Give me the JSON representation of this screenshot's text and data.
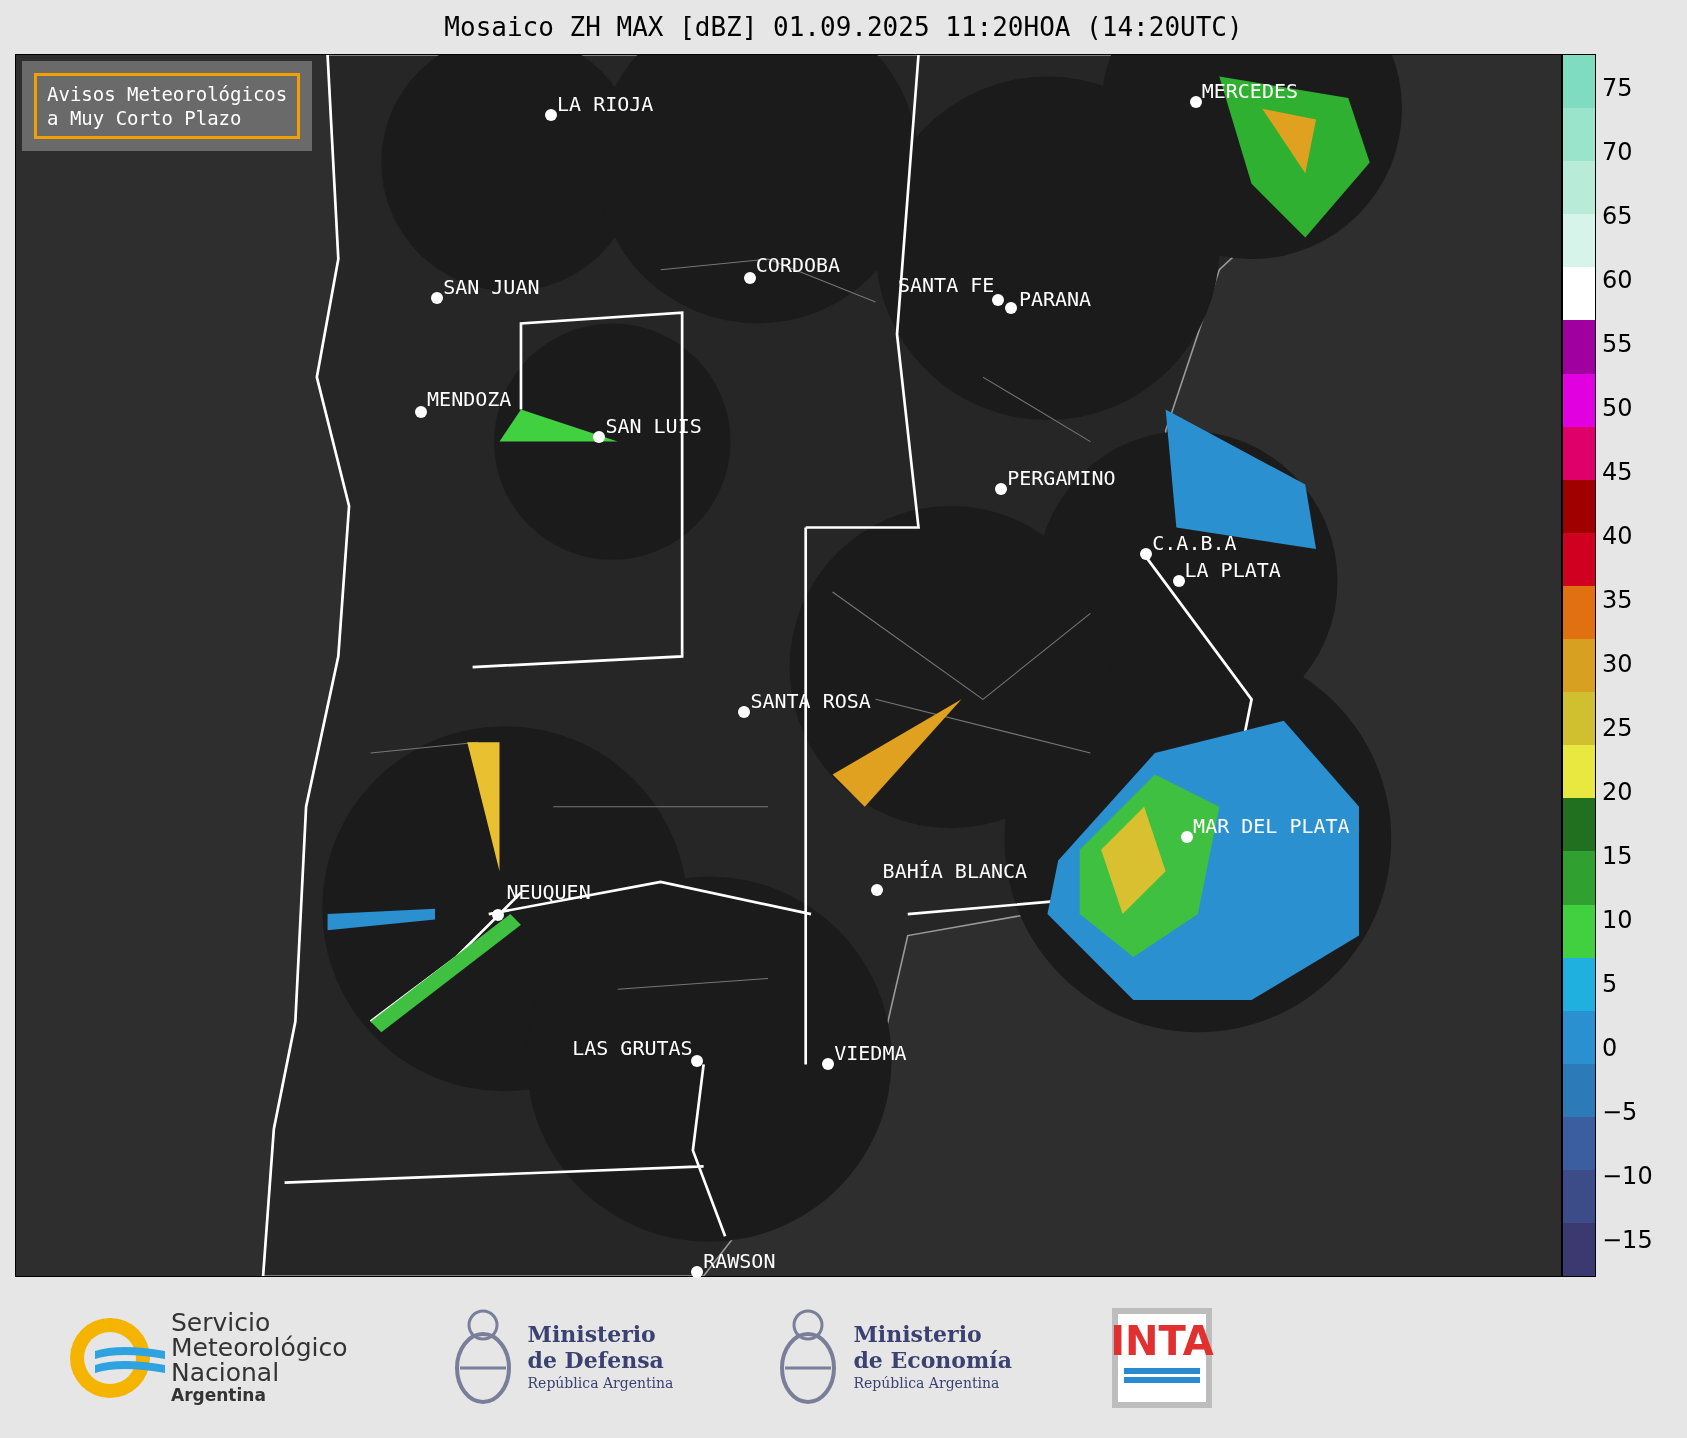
{
  "title": "Mosaico ZH MAX [dBZ] 01.09.2025 11:20HOA (14:20UTC)",
  "notice": {
    "lines": [
      "Avisos Meteorológicos",
      "a Muy Corto Plazo"
    ]
  },
  "cities": [
    {
      "name": "LA RIOJA"
    },
    {
      "name": "SAN JUAN"
    },
    {
      "name": "CORDOBA"
    },
    {
      "name": "SANTA FE"
    },
    {
      "name": "PARANA"
    },
    {
      "name": "MERCEDES"
    },
    {
      "name": "MENDOZA"
    },
    {
      "name": "SAN LUIS"
    },
    {
      "name": "PERGAMINO"
    },
    {
      "name": "C.A.B.A"
    },
    {
      "name": "LA PLATA"
    },
    {
      "name": "SANTA ROSA"
    },
    {
      "name": "MAR DEL PLATA"
    },
    {
      "name": "BAHÍA BLANCA"
    },
    {
      "name": "NEUQUEN"
    },
    {
      "name": "LAS GRUTAS"
    },
    {
      "name": "VIEDMA"
    },
    {
      "name": "RAWSON"
    }
  ],
  "colorbar": {
    "ticks": [
      "75",
      "70",
      "65",
      "60",
      "55",
      "50",
      "45",
      "40",
      "35",
      "30",
      "25",
      "20",
      "15",
      "10",
      "5",
      "0",
      "−5",
      "−10",
      "−15"
    ]
  },
  "logos": [
    {
      "kind": "smn",
      "lines": [
        "Servicio",
        "Meteorológico",
        "Nacional",
        "Argentina"
      ]
    },
    {
      "kind": "ministry",
      "lines": [
        "Ministerio",
        "de Defensa",
        "República Argentina"
      ]
    },
    {
      "kind": "ministry",
      "lines": [
        "Ministerio",
        "de Economía",
        "República Argentina"
      ]
    },
    {
      "kind": "inta",
      "lines": [
        "INTA"
      ]
    }
  ]
}
